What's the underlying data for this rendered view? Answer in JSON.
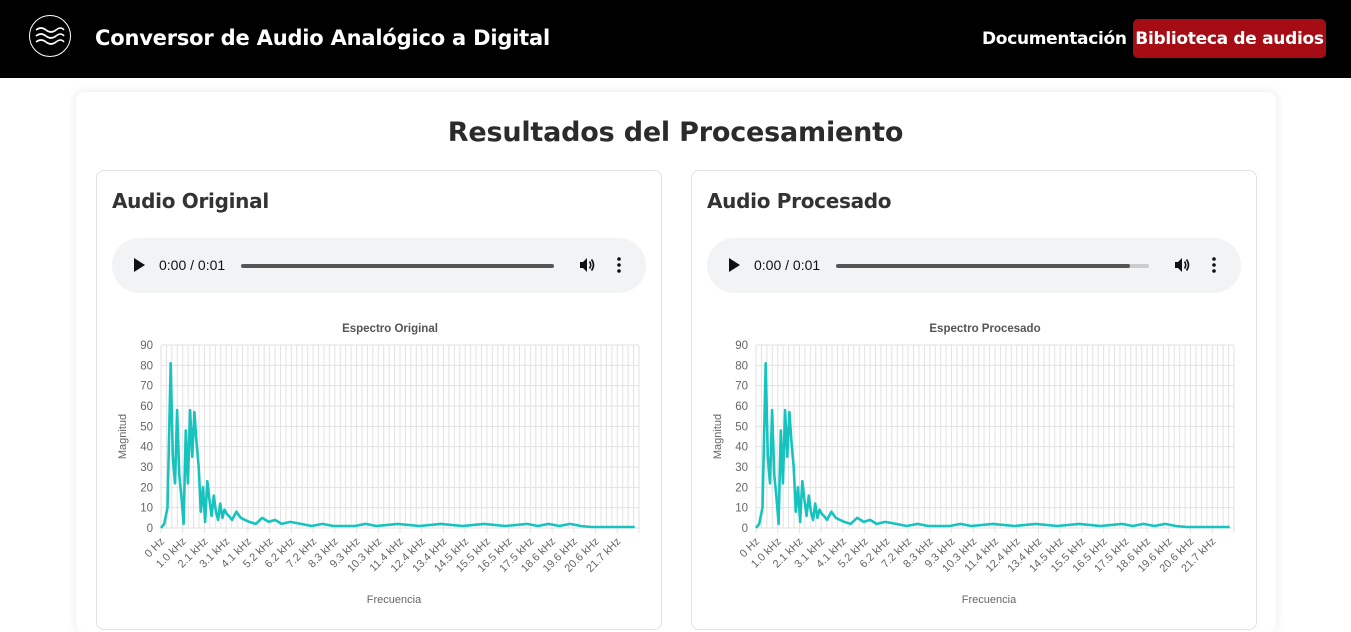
{
  "header": {
    "logo_icon": "waves-icon",
    "title": "Conversor de Audio Analógico a Digital",
    "nav_doc": "Documentación",
    "nav_library": "Biblioteca de audios",
    "accent_color": "#a50c14"
  },
  "main": {
    "title": "Resultados del Procesamiento"
  },
  "panels": [
    {
      "title": "Audio Original",
      "player": {
        "time": "0:00 / 0:01",
        "progress": 0.0
      }
    },
    {
      "title": "Audio Procesado",
      "player": {
        "time": "0:00 / 0:01",
        "progress": 0.0
      }
    }
  ],
  "chart_data": [
    {
      "type": "line",
      "title": "Espectro Original",
      "xlabel": "Frecuencia",
      "ylabel": "Magnitud",
      "ylim": [
        0,
        90
      ],
      "yticks": [
        0,
        10,
        20,
        30,
        40,
        50,
        60,
        70,
        80,
        90
      ],
      "xticks": [
        "0 Hz",
        "1.0 kHz",
        "2.1 kHz",
        "3.1 kHz",
        "4.1 kHz",
        "5.2 kHz",
        "6.2 kHz",
        "7.2 kHz",
        "8.3 kHz",
        "9.3 kHz",
        "10.3 kHz",
        "11.4 kHz",
        "12.4 kHz",
        "13.4 kHz",
        "14.5 kHz",
        "15.5 kHz",
        "16.5 kHz",
        "17.5 kHz",
        "18.6 kHz",
        "19.6 kHz",
        "20.6 kHz",
        "21.7 kHz"
      ],
      "grid": true,
      "color": "#17c3be",
      "series": [
        {
          "x_khz": [
            0,
            0.15,
            0.3,
            0.45,
            0.55,
            0.65,
            0.75,
            0.85,
            0.95,
            1.05,
            1.15,
            1.25,
            1.35,
            1.45,
            1.55,
            1.65,
            1.75,
            1.85,
            1.95,
            2.05,
            2.15,
            2.25,
            2.35,
            2.45,
            2.55,
            2.65,
            2.75,
            2.85,
            2.95,
            3.05,
            3.15,
            3.3,
            3.5,
            3.7,
            3.9,
            4.1,
            4.4,
            4.7,
            5.0,
            5.3,
            5.6,
            6.0,
            6.5,
            7.0,
            7.5,
            8.0,
            8.5,
            9.0,
            9.5,
            10.0,
            11.0,
            12.0,
            13.0,
            14.0,
            15.0,
            16.0,
            17.0,
            17.5,
            18.0,
            18.5,
            19.0,
            19.5,
            20.0,
            21.0,
            22.0
          ],
          "y": [
            0,
            2,
            10,
            81,
            35,
            22,
            58,
            26,
            15,
            2,
            48,
            22,
            58,
            35,
            57,
            42,
            30,
            8,
            20,
            3,
            23,
            14,
            6,
            16,
            8,
            4,
            12,
            5,
            9,
            7,
            6,
            4,
            8,
            5,
            4,
            3,
            2,
            5,
            3,
            4,
            2,
            3,
            2,
            1,
            2,
            1,
            1,
            1,
            2,
            1,
            2,
            1,
            2,
            1,
            2,
            1,
            2,
            1,
            2,
            1,
            2,
            1,
            0.5,
            0.5,
            0.5
          ]
        }
      ]
    },
    {
      "type": "line",
      "title": "Espectro Procesado",
      "xlabel": "Frecuencia",
      "ylabel": "Magnitud",
      "ylim": [
        0,
        90
      ],
      "yticks": [
        0,
        10,
        20,
        30,
        40,
        50,
        60,
        70,
        80,
        90
      ],
      "xticks": [
        "0 Hz",
        "1.0 kHz",
        "2.1 kHz",
        "3.1 kHz",
        "4.1 kHz",
        "5.2 kHz",
        "6.2 kHz",
        "7.2 kHz",
        "8.3 kHz",
        "9.3 kHz",
        "10.3 kHz",
        "11.4 kHz",
        "12.4 kHz",
        "13.4 kHz",
        "14.5 kHz",
        "15.5 kHz",
        "16.5 kHz",
        "17.5 kHz",
        "18.6 kHz",
        "19.6 kHz",
        "20.6 kHz",
        "21.7 kHz"
      ],
      "grid": true,
      "color": "#17c3be",
      "series": [
        {
          "x_khz": [
            0,
            0.15,
            0.3,
            0.45,
            0.55,
            0.65,
            0.75,
            0.85,
            0.95,
            1.05,
            1.15,
            1.25,
            1.35,
            1.45,
            1.55,
            1.65,
            1.75,
            1.85,
            1.95,
            2.05,
            2.15,
            2.25,
            2.35,
            2.45,
            2.55,
            2.65,
            2.75,
            2.85,
            2.95,
            3.05,
            3.15,
            3.3,
            3.5,
            3.7,
            3.9,
            4.1,
            4.4,
            4.7,
            5.0,
            5.3,
            5.6,
            6.0,
            6.5,
            7.0,
            7.5,
            8.0,
            8.5,
            9.0,
            9.5,
            10.0,
            11.0,
            12.0,
            13.0,
            14.0,
            15.0,
            16.0,
            17.0,
            17.5,
            18.0,
            18.5,
            19.0,
            19.5,
            20.0,
            21.0,
            22.0
          ],
          "y": [
            0,
            2,
            10,
            81,
            35,
            22,
            58,
            26,
            15,
            2,
            48,
            22,
            58,
            35,
            57,
            42,
            30,
            8,
            20,
            3,
            23,
            14,
            6,
            16,
            8,
            4,
            12,
            5,
            9,
            7,
            6,
            4,
            8,
            5,
            4,
            3,
            2,
            5,
            3,
            4,
            2,
            3,
            2,
            1,
            2,
            1,
            1,
            1,
            2,
            1,
            2,
            1,
            2,
            1,
            2,
            1,
            2,
            1,
            2,
            1,
            2,
            1,
            0.5,
            0.5,
            0.5
          ]
        }
      ]
    }
  ]
}
